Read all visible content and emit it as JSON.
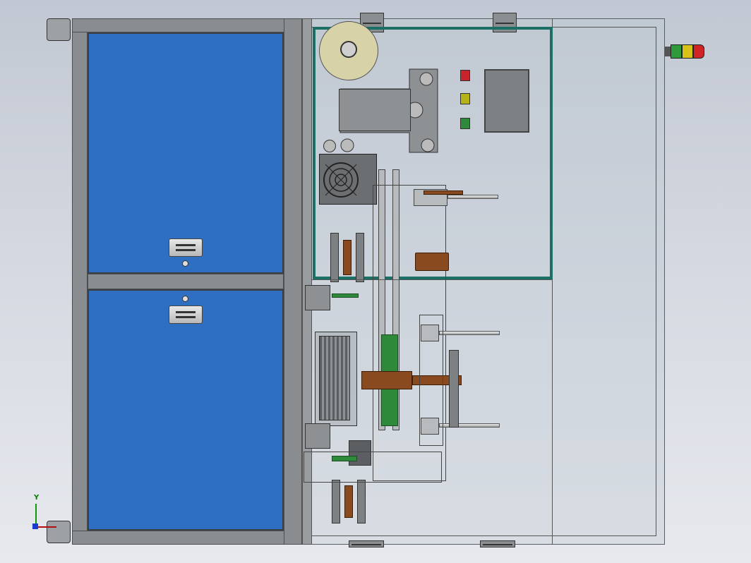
{
  "viewport": {
    "background_top": "#c2c8d3",
    "background_bottom": "#e7e9ee"
  },
  "machine": {
    "door_color": "#2f6fc1",
    "frame_color": "#8a8d8f",
    "panel_frame_color": "#1b6f64",
    "signal_tower": {
      "segments": [
        "green",
        "yellow",
        "red"
      ]
    },
    "control_panel": {
      "indicators": [
        {
          "name": "stop-indicator",
          "color": "#c8242c"
        },
        {
          "name": "warning-indicator",
          "color": "#b8b21a"
        },
        {
          "name": "run-indicator",
          "color": "#2e8a3a"
        }
      ],
      "screen": "hmi-screen"
    }
  },
  "triad": {
    "y_label": "Y"
  }
}
